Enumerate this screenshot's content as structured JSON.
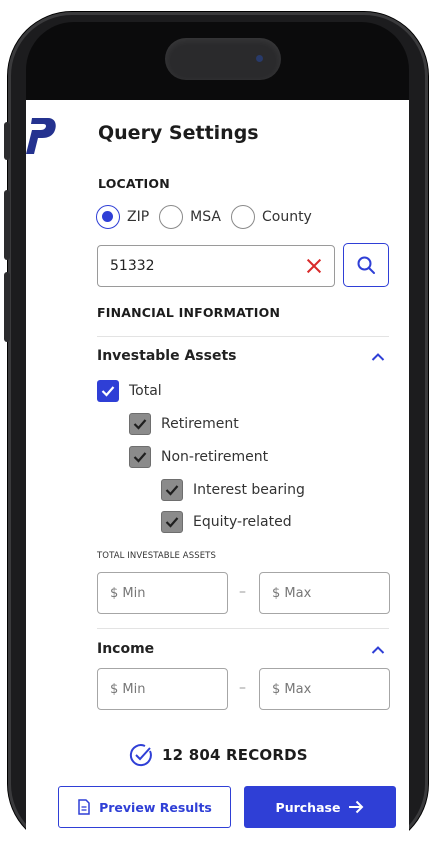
{
  "header": {
    "title": "Query Settings"
  },
  "location": {
    "label": "LOCATION",
    "options": [
      "ZIP",
      "MSA",
      "County"
    ],
    "selected": "ZIP",
    "zip_value": "51332"
  },
  "financial": {
    "label": "FINANCIAL INFORMATION",
    "investable_assets": {
      "title": "Investable Assets",
      "checkboxes": [
        {
          "label": "Total",
          "checked": true
        },
        {
          "label": "Retirement",
          "checked": true
        },
        {
          "label": "Non-retirement",
          "checked": true
        },
        {
          "label": "Interest bearing",
          "checked": true
        },
        {
          "label": "Equity-related",
          "checked": true
        }
      ],
      "range_label": "TOTAL INVESTABLE ASSETS",
      "min_placeholder": "$ Min",
      "max_placeholder": "$ Max",
      "separator": "–"
    },
    "income": {
      "title": "Income",
      "min_placeholder": "$ Min",
      "max_placeholder": "$ Max",
      "separator": "–"
    }
  },
  "records": {
    "count_text": "12 804 RECORDS"
  },
  "actions": {
    "preview_label": "Preview Results",
    "purchase_label": "Purchase"
  },
  "colors": {
    "accent": "#2f3fd6",
    "clear": "#d92a2a",
    "check_gray": "#8b8b8b"
  },
  "icons": [
    "logo-icon",
    "clear-icon",
    "search-icon",
    "chevron-up-icon",
    "check-icon",
    "check-circle-icon",
    "document-icon",
    "arrow-right-icon"
  ]
}
